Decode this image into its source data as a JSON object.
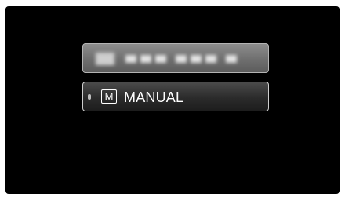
{
  "menu": {
    "blurred_item": {
      "text": ""
    },
    "selected_item": {
      "icon_letter": "M",
      "label": "MANUAL",
      "icon": "manual-mode-icon",
      "cursor_icon": "selection-cursor-icon"
    }
  },
  "colors": {
    "background": "#000000",
    "text": "#ffffff",
    "item_border": "#cfcfcf",
    "blurred_item_fill": "#7a7a7a"
  }
}
